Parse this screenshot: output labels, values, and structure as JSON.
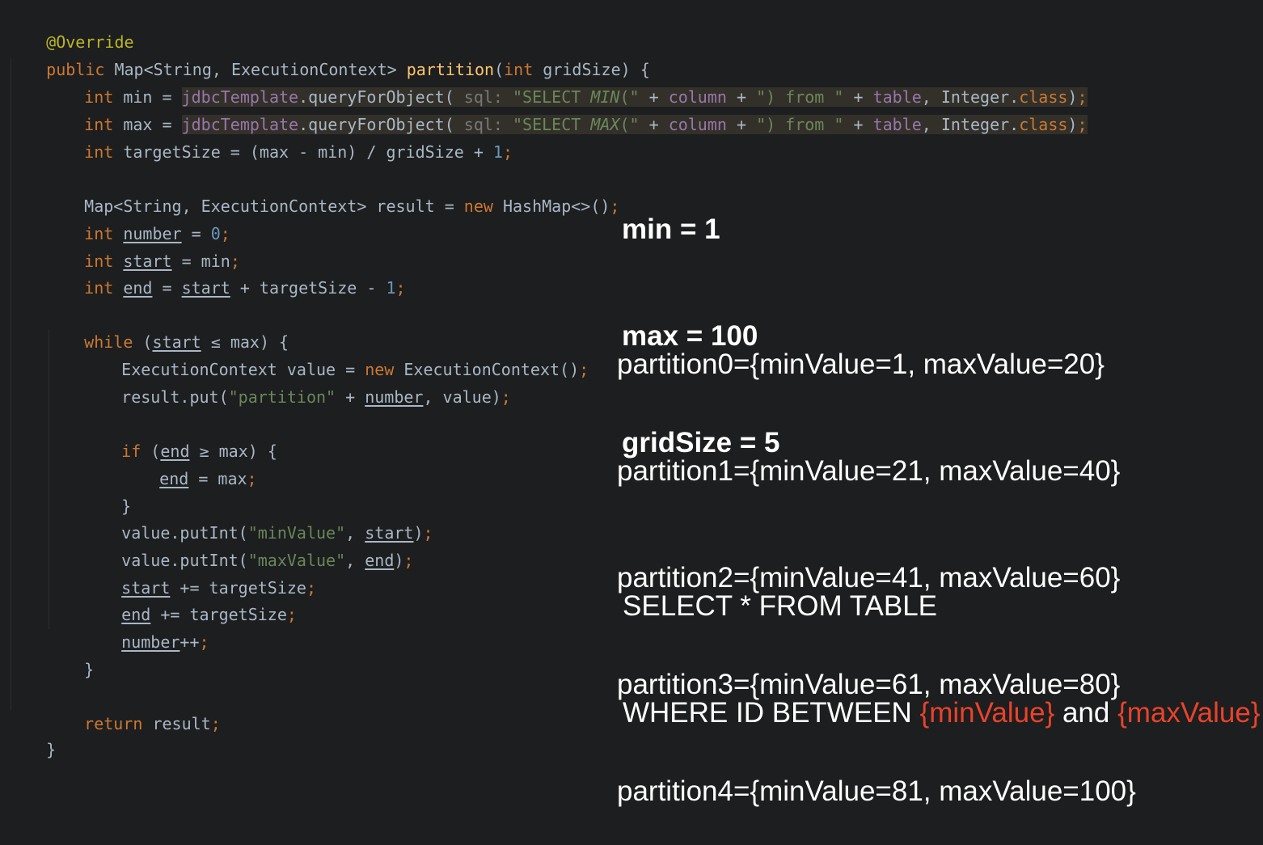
{
  "code": {
    "annotation": "@Override",
    "sig": {
      "public": "public",
      "type": " Map<String, ExecutionContext> ",
      "name": "partition",
      "open": "(",
      "int": "int",
      "rest": " gridSize) {"
    },
    "min_line": {
      "int": "int",
      "a": " min = ",
      "tpl": "jdbcTemplate",
      "b": ".queryForObject( ",
      "hint": "sql:",
      "s1": " \"SELECT ",
      "agg": "MIN",
      "s2": "(\"",
      "c": " + ",
      "col": "column",
      "d": " + ",
      "s3": "\") from \"",
      "e": " + ",
      "tab": "table",
      "f": ", Integer.",
      "cls": "class",
      "g": ")",
      "semi": ";"
    },
    "max_line": {
      "int": "int",
      "a": " max = ",
      "tpl": "jdbcTemplate",
      "b": ".queryForObject( ",
      "hint": "sql:",
      "s1": " \"SELECT ",
      "agg": "MAX",
      "s2": "(\"",
      "c": " + ",
      "col": "column",
      "d": " + ",
      "s3": "\") from \"",
      "e": " + ",
      "tab": "table",
      "f": ", Integer.",
      "cls": "class",
      "g": ")",
      "semi": ";"
    },
    "target_line": {
      "int": "int",
      "a": " targetSize = (max - min) / gridSize + ",
      "num": "1",
      "semi": ";"
    },
    "map_line": {
      "a": "Map<String, ExecutionContext> result = ",
      "new": "new",
      "b": " HashMap<>()",
      "semi": ";"
    },
    "number_line": {
      "int": "int",
      "sp": " ",
      "var": "number",
      "a": " = ",
      "num": "0",
      "semi": ";"
    },
    "start_line": {
      "int": "int",
      "sp": " ",
      "var": "start",
      "a": " = min",
      "semi": ";"
    },
    "end_line": {
      "int": "int",
      "sp": " ",
      "var": "end",
      "a": " = ",
      "var2": "start",
      "b": " + targetSize - ",
      "num": "1",
      "semi": ";"
    },
    "while_line": {
      "kw": "while",
      "a": " (",
      "var": "start",
      "b": " ≤ max) {"
    },
    "ctx_line": {
      "a": "ExecutionContext value = ",
      "new": "new",
      "b": " ExecutionContext()",
      "semi": ";"
    },
    "put_line": {
      "a": "result.put(",
      "str": "\"partition\"",
      "b": " + ",
      "var": "number",
      "c": ", value)",
      "semi": ";"
    },
    "if_line": {
      "kw": "if",
      "a": " (",
      "var": "end",
      "b": " ≥ max) {"
    },
    "assign_line": {
      "var": "end",
      "a": " = max",
      "semi": ";"
    },
    "close_if": "}",
    "putmin_line": {
      "a": "value.putInt(",
      "str": "\"minValue\"",
      "b": ", ",
      "var": "start",
      "c": ")",
      "semi": ";"
    },
    "putmax_line": {
      "a": "value.putInt(",
      "str": "\"maxValue\"",
      "b": ", ",
      "var": "end",
      "c": ")",
      "semi": ";"
    },
    "inc_start": {
      "var": "start",
      "a": " += targetSize",
      "semi": ";"
    },
    "inc_end": {
      "var": "end",
      "a": " += targetSize",
      "semi": ";"
    },
    "inc_num": {
      "var": "number",
      "a": "++",
      "semi": ";"
    },
    "close_while": "}",
    "return_line": {
      "kw": "return",
      "a": " result",
      "semi": ";"
    },
    "close_method": "}"
  },
  "notes": {
    "vars": [
      "min = 1",
      "max = 100",
      "gridSize = 5"
    ],
    "partitions": [
      "partition0={minValue=1, maxValue=20}",
      "partition1={minValue=21, maxValue=40}",
      "partition2={minValue=41, maxValue=60}",
      "partition3={minValue=61, maxValue=80}",
      "partition4={minValue=81, maxValue=100}"
    ],
    "sql": {
      "line1": "SELECT * FROM TABLE",
      "prefix": "WHERE ID BETWEEN ",
      "min": "{minValue}",
      "and": " and ",
      "max": "{maxValue}"
    }
  },
  "colors": {
    "background": "#1d1e1f",
    "keyword": "#cc7832",
    "function": "#ffc66d",
    "string": "#6a8759",
    "number": "#6897bb",
    "field": "#9876aa",
    "annotation": "#bbb529",
    "highlight_red": "#e8432b"
  }
}
